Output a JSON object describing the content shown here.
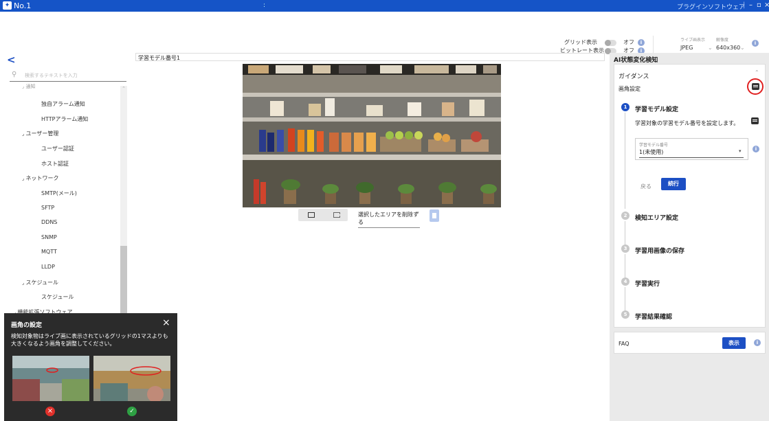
{
  "titlebar": {
    "title": "No.1",
    "middle": ":",
    "right": "プラグインソフトウェア",
    "sep": "|",
    "minimize": "–",
    "maximize": "▫",
    "close": "×"
  },
  "toolbar": {
    "grid_label": "グリッド表示",
    "grid_value": "オフ",
    "bitrate_label": "ビットレート表示",
    "bitrate_value": "オフ",
    "live_label": "ライブ画表示",
    "live_value": "JPEG",
    "res_label": "解像度",
    "res_value": "640x360"
  },
  "sidebar": {
    "back": "<",
    "search_placeholder": "検索するテキストを入力",
    "items": [
      {
        "label": "通知",
        "level": 1
      },
      {
        "label": "独自アラーム通知",
        "level": 2
      },
      {
        "label": "HTTPアラーム通知",
        "level": 2
      },
      {
        "label": "ユーザー管理",
        "level": 1
      },
      {
        "label": "ユーザー認証",
        "level": 2
      },
      {
        "label": "ホスト認証",
        "level": 2
      },
      {
        "label": "ネットワーク",
        "level": 1
      },
      {
        "label": "SMTP(メール)",
        "level": 2
      },
      {
        "label": "SFTP",
        "level": 2
      },
      {
        "label": "DDNS",
        "level": 2
      },
      {
        "label": "SNMP",
        "level": 2
      },
      {
        "label": "MQTT",
        "level": 2
      },
      {
        "label": "LLDP",
        "level": 2
      },
      {
        "label": "スケジュール",
        "level": 1
      },
      {
        "label": "スケジュール",
        "level": 2
      },
      {
        "label": "機能拡張ソフトウェア",
        "level": 0
      }
    ]
  },
  "popup": {
    "title": "画角の設定",
    "body": "検知対象物はライブ画に表示されているグリッドの1マスよりも大きくなるよう画角を調整してください。",
    "close": "×"
  },
  "center": {
    "header": "学習モデル番号1",
    "delete_select": "選択したエリアを削除する"
  },
  "panel": {
    "title": "AI状態変化検知",
    "guidance": "ガイダンス",
    "angle_setting": "画角設定",
    "steps": [
      {
        "num": "1",
        "label": "学習モデル設定"
      },
      {
        "num": "2",
        "label": "検知エリア設定"
      },
      {
        "num": "3",
        "label": "学習用画像の保存"
      },
      {
        "num": "4",
        "label": "学習実行"
      },
      {
        "num": "5",
        "label": "学習結果確認"
      }
    ],
    "step1_desc": "学習対象の学習モデル番号を設定します。",
    "model_field_label": "学習モデル番号",
    "model_field_value": "1(未使用)",
    "back_button": "戻る",
    "next_button": "続行",
    "faq": "FAQ",
    "show_button": "表示"
  }
}
